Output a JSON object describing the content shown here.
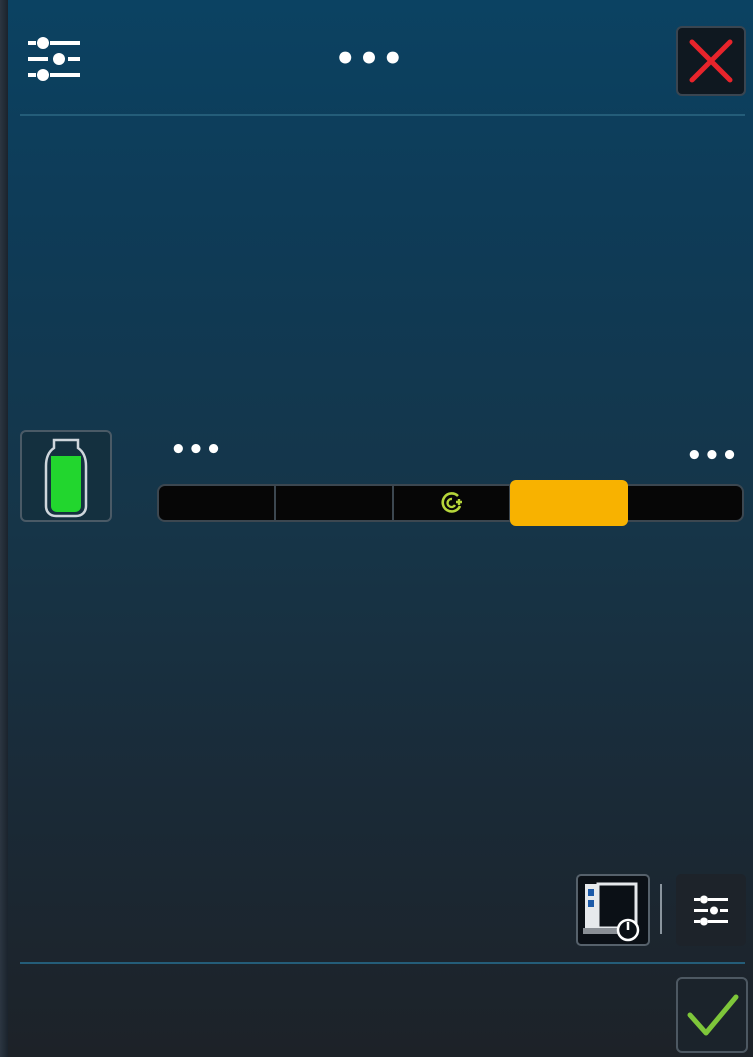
{
  "header": {
    "title": "•••",
    "settings_icon": "sliders-icon",
    "close_icon": "close-x-icon",
    "close_color": "#e8242b"
  },
  "cleaner": {
    "icon": "cleaner-bottle-icon",
    "fill_color": "#22d62e",
    "fill_level": 0.8
  },
  "intensity": {
    "label_left": "•••",
    "label_right": "•••",
    "segments": [
      "",
      "",
      "eco-icon",
      "",
      ""
    ],
    "selected_index": 3,
    "selected_color": "#f8b200",
    "eco_color": "#b6d63a"
  },
  "footer": {
    "power_icon": "oven-power-icon",
    "settings_icon": "sliders-icon",
    "confirm_icon": "checkmark-icon",
    "confirm_color": "#7ec63a"
  }
}
